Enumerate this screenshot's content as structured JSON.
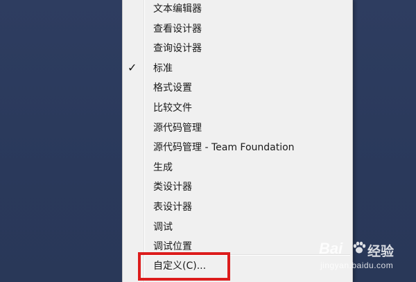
{
  "menu": {
    "items": [
      {
        "label": "文本编辑器",
        "checked": false
      },
      {
        "label": "查看设计器",
        "checked": false
      },
      {
        "label": "查询设计器",
        "checked": false
      },
      {
        "label": "标准",
        "checked": true
      },
      {
        "label": "格式设置",
        "checked": false
      },
      {
        "label": "比较文件",
        "checked": false
      },
      {
        "label": "源代码管理",
        "checked": false
      },
      {
        "label": "源代码管理 - Team Foundation",
        "checked": false
      },
      {
        "label": "生成",
        "checked": false
      },
      {
        "label": "类设计器",
        "checked": false
      },
      {
        "label": "表设计器",
        "checked": false
      },
      {
        "label": "调试",
        "checked": false
      },
      {
        "label": "调试位置",
        "checked": false
      }
    ],
    "customize_label": "自定义(C)...",
    "check_glyph": "✓"
  },
  "watermark": {
    "logo": "Bai",
    "text": "经验",
    "url": "jingyan.baidu.com"
  },
  "colors": {
    "desktop": "#2b3a5e",
    "menu_bg": "#f0f0f0",
    "highlight": "#dc1c1c"
  }
}
